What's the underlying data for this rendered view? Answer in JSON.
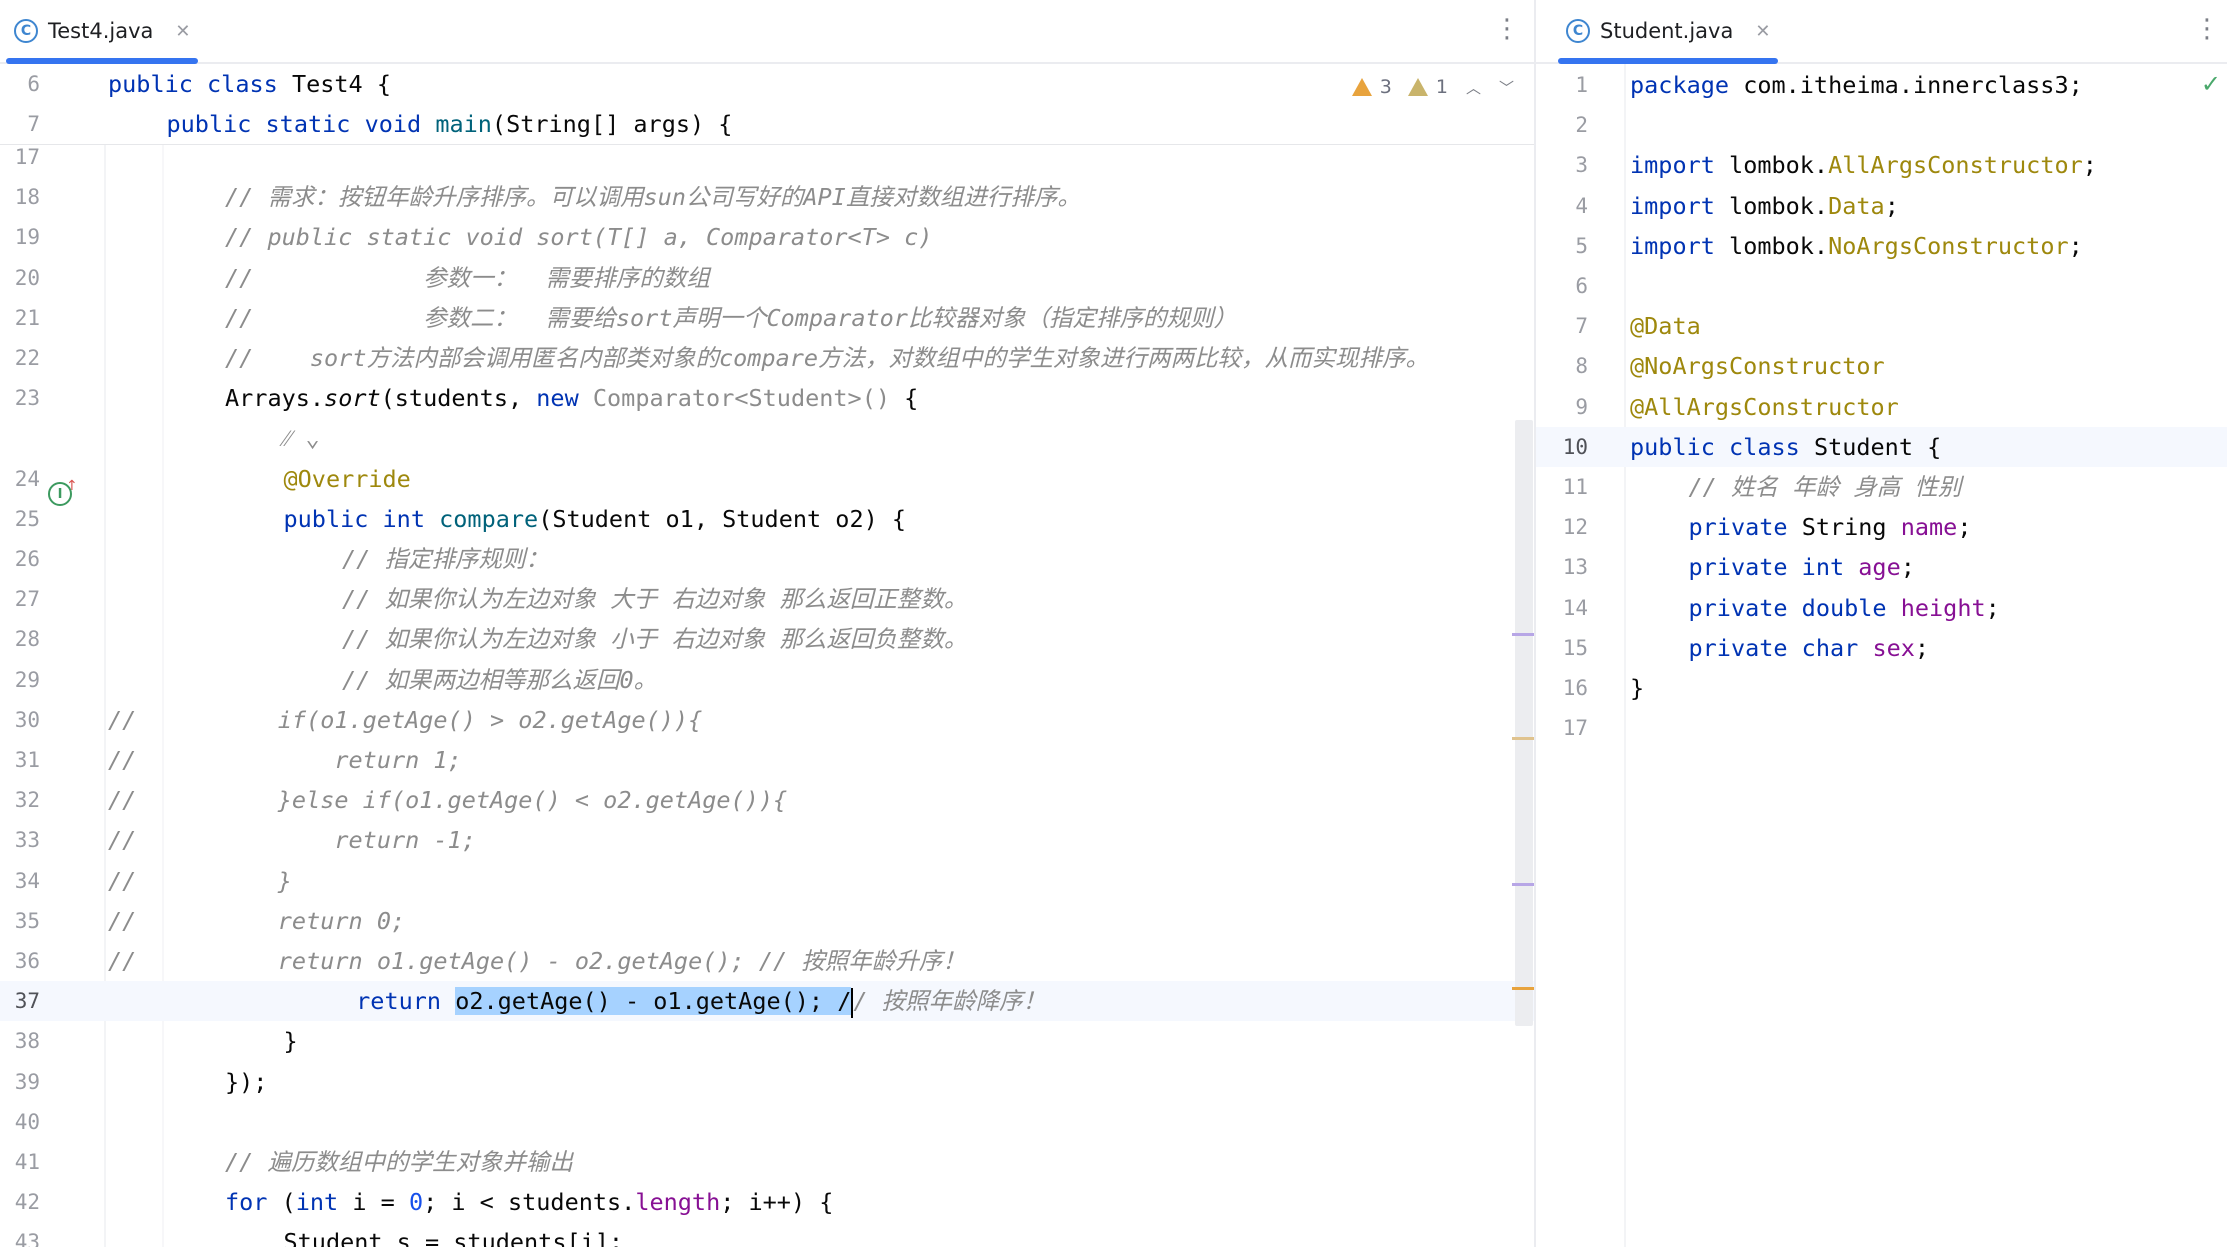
{
  "left": {
    "tab": {
      "label": "Test4.java",
      "icon": "class-icon"
    },
    "inspections": {
      "warnings": "3",
      "weak_warnings": "1"
    },
    "sticky": [
      {
        "n": "6",
        "indent": 0,
        "t": [
          [
            "kw",
            "public class "
          ],
          [
            "",
            "Test4 {"
          ]
        ]
      },
      {
        "n": "7",
        "indent": 1,
        "t": [
          [
            "kw",
            "public static void "
          ],
          [
            "meth",
            "main"
          ],
          [
            "",
            "(String[] args) {"
          ]
        ]
      }
    ],
    "lines": [
      {
        "n": "17",
        "indent": 0,
        "t": []
      },
      {
        "n": "18",
        "indent": 2,
        "t": [
          [
            "cm",
            "// 需求：按钮年龄升序排序。可以调用sun公司写好的API直接对数组进行排序。"
          ]
        ]
      },
      {
        "n": "19",
        "indent": 2,
        "t": [
          [
            "cm",
            "// public static void sort(T[] a, Comparator<T> c)"
          ]
        ]
      },
      {
        "n": "20",
        "indent": 2,
        "t": [
          [
            "cm",
            "//            参数一：  需要排序的数组"
          ]
        ]
      },
      {
        "n": "21",
        "indent": 2,
        "t": [
          [
            "cm",
            "//            参数二：  需要给sort声明一个Comparator比较器对象（指定排序的规则）"
          ]
        ]
      },
      {
        "n": "22",
        "indent": 2,
        "t": [
          [
            "cm",
            "//    sort方法内部会调用匿名内部类对象的compare方法，对数组中的学生对象进行两两比较，从而实现排序。"
          ]
        ]
      },
      {
        "n": "23",
        "indent": 2,
        "t": [
          [
            "",
            "Arrays."
          ],
          [
            "it",
            "sort"
          ],
          [
            "",
            "(students, "
          ],
          [
            "kw",
            "new "
          ],
          [
            "sm",
            "Comparator<Student>() "
          ],
          [
            "",
            "{"
          ]
        ]
      },
      {
        "n": "",
        "indent": 3,
        "t": [
          [
            "sm",
            "⁄⁄ ⌄"
          ]
        ]
      },
      {
        "n": "24",
        "indent": 3,
        "t": [
          [
            "an",
            "@Override"
          ]
        ]
      },
      {
        "n": "25",
        "indent": 3,
        "t": [
          [
            "kw",
            "public int "
          ],
          [
            "meth",
            "compare"
          ],
          [
            "",
            "(Student o1, Student o2) {"
          ]
        ]
      },
      {
        "n": "26",
        "indent": 4,
        "t": [
          [
            "cm",
            "// 指定排序规则："
          ]
        ]
      },
      {
        "n": "27",
        "indent": 4,
        "t": [
          [
            "cm",
            "// 如果你认为左边对象 大于 右边对象 那么返回正整数。"
          ]
        ]
      },
      {
        "n": "28",
        "indent": 4,
        "t": [
          [
            "cm",
            "// 如果你认为左边对象 小于 右边对象 那么返回负整数。"
          ]
        ]
      },
      {
        "n": "29",
        "indent": 4,
        "t": [
          [
            "cm",
            "// 如果两边相等那么返回0。"
          ]
        ]
      },
      {
        "n": "30",
        "indent": 0,
        "t": [
          [
            "cm",
            "//          if(o1.getAge() > o2.getAge()){"
          ]
        ]
      },
      {
        "n": "31",
        "indent": 0,
        "t": [
          [
            "cm",
            "//              return 1;"
          ]
        ]
      },
      {
        "n": "32",
        "indent": 0,
        "t": [
          [
            "cm",
            "//          }else if(o1.getAge() < o2.getAge()){"
          ]
        ]
      },
      {
        "n": "33",
        "indent": 0,
        "t": [
          [
            "cm",
            "//              return -1;"
          ]
        ]
      },
      {
        "n": "34",
        "indent": 0,
        "t": [
          [
            "cm",
            "//          }"
          ]
        ]
      },
      {
        "n": "35",
        "indent": 0,
        "t": [
          [
            "cm",
            "//          return 0;"
          ]
        ]
      },
      {
        "n": "36",
        "indent": 0,
        "t": [
          [
            "cm",
            "//          return o1.getAge() - o2.getAge(); // 按照年龄升序！"
          ]
        ]
      },
      {
        "n": "37",
        "indent": 4,
        "pad": " ",
        "current": true,
        "t": [
          [
            "kw",
            "return "
          ],
          [
            "sel",
            "o2.getAge() - o1.getAge(); /"
          ],
          [
            "caret",
            ""
          ],
          [
            "cm",
            "/ 按照年龄降序！"
          ]
        ]
      },
      {
        "n": "38",
        "indent": 3,
        "t": [
          [
            "",
            "}"
          ]
        ]
      },
      {
        "n": "39",
        "indent": 2,
        "t": [
          [
            "",
            "});"
          ]
        ]
      },
      {
        "n": "40",
        "indent": 0,
        "t": []
      },
      {
        "n": "41",
        "indent": 2,
        "t": [
          [
            "cm",
            "// 遍历数组中的学生对象并输出"
          ]
        ]
      },
      {
        "n": "42",
        "indent": 2,
        "t": [
          [
            "kw",
            "for "
          ],
          [
            "",
            "("
          ],
          [
            "kw",
            "int "
          ],
          [
            "",
            "i = "
          ],
          [
            "num",
            "0"
          ],
          [
            "",
            "; i < students."
          ],
          [
            "fld",
            "length"
          ],
          [
            "",
            "; i++) {"
          ]
        ]
      },
      {
        "n": "43",
        "indent": 3,
        "t": [
          [
            "",
            "Student s = students[i];"
          ]
        ]
      }
    ]
  },
  "right": {
    "tab": {
      "label": "Student.java",
      "icon": "class-icon"
    },
    "lines": [
      {
        "n": "1",
        "indent": 0,
        "t": [
          [
            "kw",
            "package "
          ],
          [
            "",
            "com.itheima.innerclass3;"
          ]
        ]
      },
      {
        "n": "2",
        "indent": 0,
        "t": []
      },
      {
        "n": "3",
        "indent": 0,
        "t": [
          [
            "kw",
            "import "
          ],
          [
            "",
            "lombok."
          ],
          [
            "an",
            "AllArgsConstructor"
          ],
          [
            "",
            ";"
          ]
        ]
      },
      {
        "n": "4",
        "indent": 0,
        "t": [
          [
            "kw",
            "import "
          ],
          [
            "",
            "lombok."
          ],
          [
            "an",
            "Data"
          ],
          [
            "",
            ";"
          ]
        ]
      },
      {
        "n": "5",
        "indent": 0,
        "t": [
          [
            "kw",
            "import "
          ],
          [
            "",
            "lombok."
          ],
          [
            "an",
            "NoArgsConstructor"
          ],
          [
            "",
            ";"
          ]
        ]
      },
      {
        "n": "6",
        "indent": 0,
        "t": []
      },
      {
        "n": "7",
        "indent": 0,
        "t": [
          [
            "an",
            "@Data"
          ]
        ]
      },
      {
        "n": "8",
        "indent": 0,
        "t": [
          [
            "an",
            "@NoArgsConstructor"
          ]
        ]
      },
      {
        "n": "9",
        "indent": 0,
        "t": [
          [
            "an",
            "@AllArgsConstructor"
          ]
        ]
      },
      {
        "n": "10",
        "indent": 0,
        "current": true,
        "t": [
          [
            "kw",
            "public class "
          ],
          [
            "",
            "Student {"
          ]
        ]
      },
      {
        "n": "11",
        "indent": 1,
        "t": [
          [
            "cm",
            "// 姓名 年龄 身高 性别"
          ]
        ]
      },
      {
        "n": "12",
        "indent": 1,
        "t": [
          [
            "kw",
            "private "
          ],
          [
            "",
            "String "
          ],
          [
            "fld",
            "name"
          ],
          [
            "",
            ";"
          ]
        ]
      },
      {
        "n": "13",
        "indent": 1,
        "t": [
          [
            "kw",
            "private int "
          ],
          [
            "fld",
            "age"
          ],
          [
            "",
            ";"
          ]
        ]
      },
      {
        "n": "14",
        "indent": 1,
        "t": [
          [
            "kw",
            "private double "
          ],
          [
            "fld",
            "height"
          ],
          [
            "",
            ";"
          ]
        ]
      },
      {
        "n": "15",
        "indent": 1,
        "t": [
          [
            "kw",
            "private char "
          ],
          [
            "fld",
            "sex"
          ],
          [
            "",
            ";"
          ]
        ]
      },
      {
        "n": "16",
        "indent": 0,
        "t": [
          [
            "",
            "}"
          ]
        ]
      },
      {
        "n": "17",
        "indent": 0,
        "t": []
      }
    ]
  },
  "colors": {
    "keyword": "#0033b3",
    "comment": "#8c8c8c",
    "annotation": "#9e880d",
    "field": "#871094",
    "selection": "#a6d2ff",
    "accent": "#3574f0"
  }
}
